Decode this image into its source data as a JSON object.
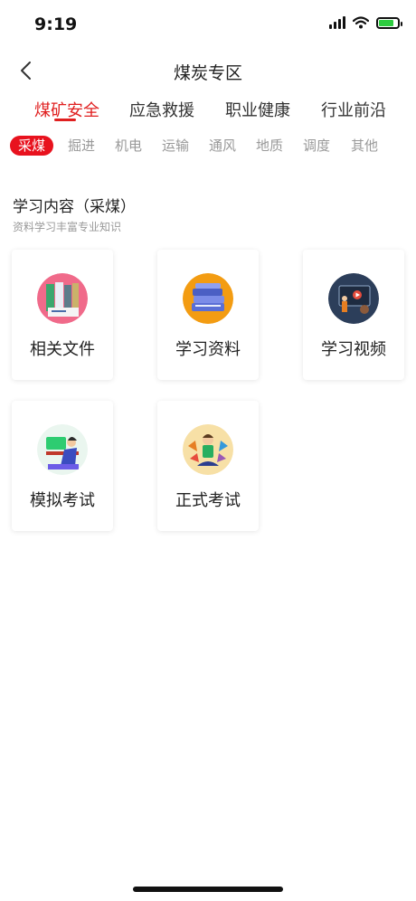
{
  "status_bar": {
    "time": "9:19"
  },
  "header": {
    "title": "煤炭专区"
  },
  "tabs": [
    {
      "label": "煤矿安全",
      "active": true
    },
    {
      "label": "应急救援",
      "active": false
    },
    {
      "label": "职业健康",
      "active": false
    },
    {
      "label": "行业前沿",
      "active": false
    }
  ],
  "subtabs": [
    {
      "label": "采煤",
      "active": true
    },
    {
      "label": "掘进"
    },
    {
      "label": "机电"
    },
    {
      "label": "运输"
    },
    {
      "label": "通风"
    },
    {
      "label": "地质"
    },
    {
      "label": "调度"
    },
    {
      "label": "其他"
    }
  ],
  "section": {
    "title": "学习内容（采煤）",
    "subtitle": "资料学习丰富专业知识"
  },
  "cards": [
    {
      "label": "相关文件",
      "icon": "documents-icon"
    },
    {
      "label": "学习资料",
      "icon": "books-icon"
    },
    {
      "label": "学习视频",
      "icon": "video-icon"
    },
    {
      "label": "模拟考试",
      "icon": "mock-exam-icon"
    },
    {
      "label": "正式考试",
      "icon": "exam-icon"
    }
  ],
  "colors": {
    "accent": "#e02020",
    "muted": "#999999"
  }
}
